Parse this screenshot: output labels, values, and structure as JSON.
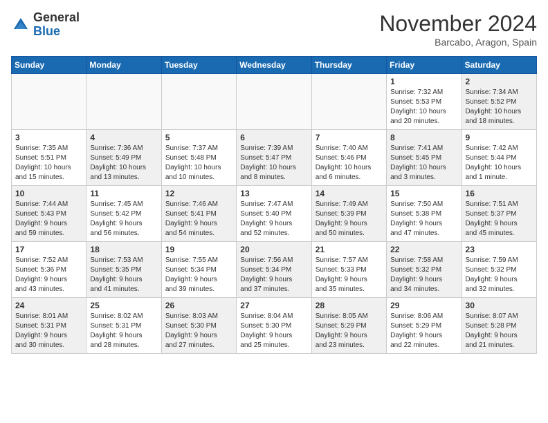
{
  "header": {
    "logo_general": "General",
    "logo_blue": "Blue",
    "month_title": "November 2024",
    "location": "Barcabo, Aragon, Spain"
  },
  "days_of_week": [
    "Sunday",
    "Monday",
    "Tuesday",
    "Wednesday",
    "Thursday",
    "Friday",
    "Saturday"
  ],
  "weeks": [
    [
      {
        "day": "",
        "info": "",
        "empty": true
      },
      {
        "day": "",
        "info": "",
        "empty": true
      },
      {
        "day": "",
        "info": "",
        "empty": true
      },
      {
        "day": "",
        "info": "",
        "empty": true
      },
      {
        "day": "",
        "info": "",
        "empty": true
      },
      {
        "day": "1",
        "info": "Sunrise: 7:32 AM\nSunset: 5:53 PM\nDaylight: 10 hours\nand 20 minutes.",
        "empty": false
      },
      {
        "day": "2",
        "info": "Sunrise: 7:34 AM\nSunset: 5:52 PM\nDaylight: 10 hours\nand 18 minutes.",
        "empty": false,
        "shaded": true
      }
    ],
    [
      {
        "day": "3",
        "info": "Sunrise: 7:35 AM\nSunset: 5:51 PM\nDaylight: 10 hours\nand 15 minutes.",
        "empty": false
      },
      {
        "day": "4",
        "info": "Sunrise: 7:36 AM\nSunset: 5:49 PM\nDaylight: 10 hours\nand 13 minutes.",
        "empty": false,
        "shaded": true
      },
      {
        "day": "5",
        "info": "Sunrise: 7:37 AM\nSunset: 5:48 PM\nDaylight: 10 hours\nand 10 minutes.",
        "empty": false
      },
      {
        "day": "6",
        "info": "Sunrise: 7:39 AM\nSunset: 5:47 PM\nDaylight: 10 hours\nand 8 minutes.",
        "empty": false,
        "shaded": true
      },
      {
        "day": "7",
        "info": "Sunrise: 7:40 AM\nSunset: 5:46 PM\nDaylight: 10 hours\nand 6 minutes.",
        "empty": false
      },
      {
        "day": "8",
        "info": "Sunrise: 7:41 AM\nSunset: 5:45 PM\nDaylight: 10 hours\nand 3 minutes.",
        "empty": false,
        "shaded": true
      },
      {
        "day": "9",
        "info": "Sunrise: 7:42 AM\nSunset: 5:44 PM\nDaylight: 10 hours\nand 1 minute.",
        "empty": false
      }
    ],
    [
      {
        "day": "10",
        "info": "Sunrise: 7:44 AM\nSunset: 5:43 PM\nDaylight: 9 hours\nand 59 minutes.",
        "empty": false,
        "shaded": true
      },
      {
        "day": "11",
        "info": "Sunrise: 7:45 AM\nSunset: 5:42 PM\nDaylight: 9 hours\nand 56 minutes.",
        "empty": false
      },
      {
        "day": "12",
        "info": "Sunrise: 7:46 AM\nSunset: 5:41 PM\nDaylight: 9 hours\nand 54 minutes.",
        "empty": false,
        "shaded": true
      },
      {
        "day": "13",
        "info": "Sunrise: 7:47 AM\nSunset: 5:40 PM\nDaylight: 9 hours\nand 52 minutes.",
        "empty": false
      },
      {
        "day": "14",
        "info": "Sunrise: 7:49 AM\nSunset: 5:39 PM\nDaylight: 9 hours\nand 50 minutes.",
        "empty": false,
        "shaded": true
      },
      {
        "day": "15",
        "info": "Sunrise: 7:50 AM\nSunset: 5:38 PM\nDaylight: 9 hours\nand 47 minutes.",
        "empty": false
      },
      {
        "day": "16",
        "info": "Sunrise: 7:51 AM\nSunset: 5:37 PM\nDaylight: 9 hours\nand 45 minutes.",
        "empty": false,
        "shaded": true
      }
    ],
    [
      {
        "day": "17",
        "info": "Sunrise: 7:52 AM\nSunset: 5:36 PM\nDaylight: 9 hours\nand 43 minutes.",
        "empty": false
      },
      {
        "day": "18",
        "info": "Sunrise: 7:53 AM\nSunset: 5:35 PM\nDaylight: 9 hours\nand 41 minutes.",
        "empty": false,
        "shaded": true
      },
      {
        "day": "19",
        "info": "Sunrise: 7:55 AM\nSunset: 5:34 PM\nDaylight: 9 hours\nand 39 minutes.",
        "empty": false
      },
      {
        "day": "20",
        "info": "Sunrise: 7:56 AM\nSunset: 5:34 PM\nDaylight: 9 hours\nand 37 minutes.",
        "empty": false,
        "shaded": true
      },
      {
        "day": "21",
        "info": "Sunrise: 7:57 AM\nSunset: 5:33 PM\nDaylight: 9 hours\nand 35 minutes.",
        "empty": false
      },
      {
        "day": "22",
        "info": "Sunrise: 7:58 AM\nSunset: 5:32 PM\nDaylight: 9 hours\nand 34 minutes.",
        "empty": false,
        "shaded": true
      },
      {
        "day": "23",
        "info": "Sunrise: 7:59 AM\nSunset: 5:32 PM\nDaylight: 9 hours\nand 32 minutes.",
        "empty": false
      }
    ],
    [
      {
        "day": "24",
        "info": "Sunrise: 8:01 AM\nSunset: 5:31 PM\nDaylight: 9 hours\nand 30 minutes.",
        "empty": false,
        "shaded": true
      },
      {
        "day": "25",
        "info": "Sunrise: 8:02 AM\nSunset: 5:31 PM\nDaylight: 9 hours\nand 28 minutes.",
        "empty": false
      },
      {
        "day": "26",
        "info": "Sunrise: 8:03 AM\nSunset: 5:30 PM\nDaylight: 9 hours\nand 27 minutes.",
        "empty": false,
        "shaded": true
      },
      {
        "day": "27",
        "info": "Sunrise: 8:04 AM\nSunset: 5:30 PM\nDaylight: 9 hours\nand 25 minutes.",
        "empty": false
      },
      {
        "day": "28",
        "info": "Sunrise: 8:05 AM\nSunset: 5:29 PM\nDaylight: 9 hours\nand 23 minutes.",
        "empty": false,
        "shaded": true
      },
      {
        "day": "29",
        "info": "Sunrise: 8:06 AM\nSunset: 5:29 PM\nDaylight: 9 hours\nand 22 minutes.",
        "empty": false
      },
      {
        "day": "30",
        "info": "Sunrise: 8:07 AM\nSunset: 5:28 PM\nDaylight: 9 hours\nand 21 minutes.",
        "empty": false,
        "shaded": true
      }
    ]
  ]
}
